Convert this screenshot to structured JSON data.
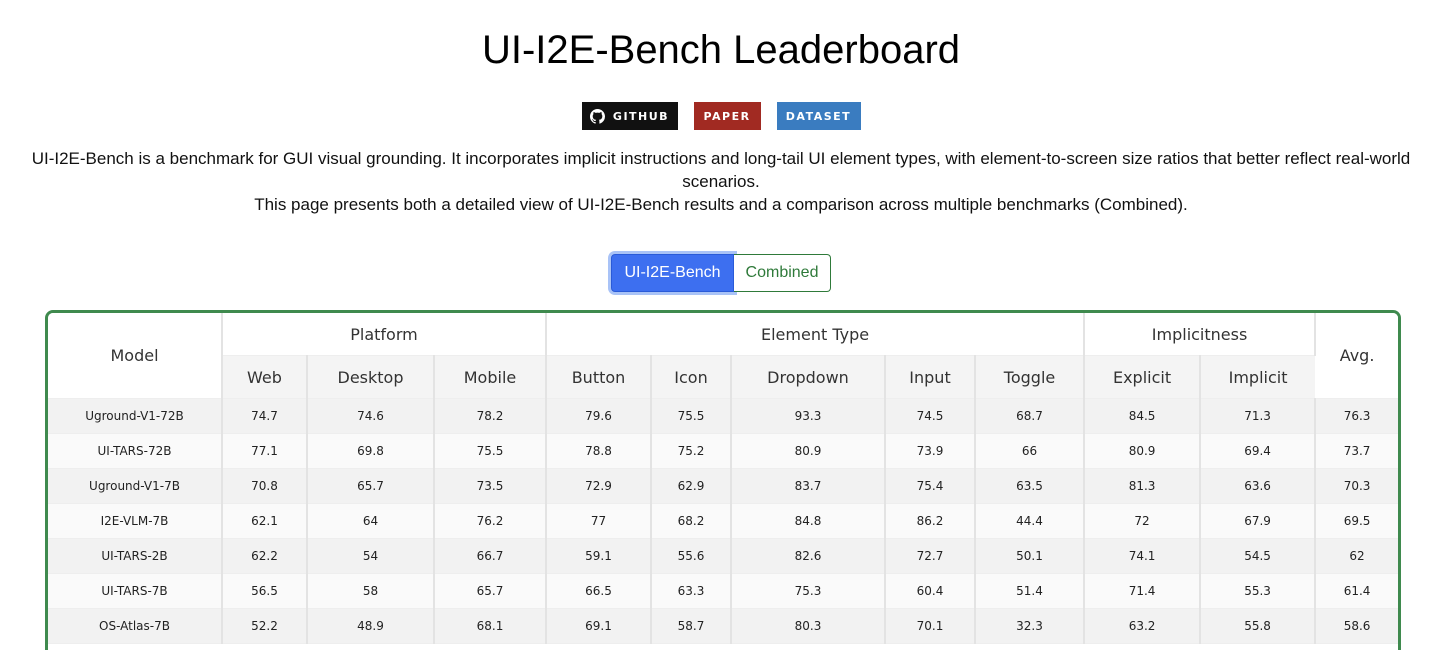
{
  "page": {
    "title": "UI-I2E-Bench Leaderboard",
    "description_line1": "UI-I2E-Bench is a benchmark for GUI visual grounding. It incorporates implicit instructions and long-tail UI element types, with element-to-screen size ratios that better reflect real-world scenarios.",
    "description_line2": "This page presents both a detailed view of UI-I2E-Bench results and a comparison across multiple benchmarks (Combined)."
  },
  "badges": {
    "github": {
      "label": "GITHUB",
      "icon": "github-icon",
      "color": "#111111"
    },
    "paper": {
      "label": "PAPER",
      "color": "#a12a22"
    },
    "dataset": {
      "label": "DATASET",
      "color": "#3a7cc0"
    }
  },
  "view_toggle": {
    "options": [
      "UI-I2E-Bench",
      "Combined"
    ],
    "selected": "UI-I2E-Bench",
    "active_color": "#3d6ff0",
    "inactive_color": "#2f7a3a"
  },
  "table": {
    "groups": {
      "model": "Model",
      "platform": "Platform",
      "element_type": "Element Type",
      "implicitness": "Implicitness",
      "avg": "Avg."
    },
    "subheaders": [
      "Web",
      "Desktop",
      "Mobile",
      "Button",
      "Icon",
      "Dropdown",
      "Input",
      "Toggle",
      "Explicit",
      "Implicit"
    ],
    "rows": [
      [
        "Uground-V1-72B",
        "74.7",
        "74.6",
        "78.2",
        "79.6",
        "75.5",
        "93.3",
        "74.5",
        "68.7",
        "84.5",
        "71.3",
        "76.3"
      ],
      [
        "UI-TARS-72B",
        "77.1",
        "69.8",
        "75.5",
        "78.8",
        "75.2",
        "80.9",
        "73.9",
        "66",
        "80.9",
        "69.4",
        "73.7"
      ],
      [
        "Uground-V1-7B",
        "70.8",
        "65.7",
        "73.5",
        "72.9",
        "62.9",
        "83.7",
        "75.4",
        "63.5",
        "81.3",
        "63.6",
        "70.3"
      ],
      [
        "I2E-VLM-7B",
        "62.1",
        "64",
        "76.2",
        "77",
        "68.2",
        "84.8",
        "86.2",
        "44.4",
        "72",
        "67.9",
        "69.5"
      ],
      [
        "UI-TARS-2B",
        "62.2",
        "54",
        "66.7",
        "59.1",
        "55.6",
        "82.6",
        "72.7",
        "50.1",
        "74.1",
        "54.5",
        "62"
      ],
      [
        "UI-TARS-7B",
        "56.5",
        "58",
        "65.7",
        "66.5",
        "63.3",
        "75.3",
        "60.4",
        "51.4",
        "71.4",
        "55.3",
        "61.4"
      ],
      [
        "OS-Atlas-7B",
        "52.2",
        "48.9",
        "68.1",
        "69.1",
        "58.7",
        "80.3",
        "70.1",
        "32.3",
        "63.2",
        "55.8",
        "58.6"
      ]
    ],
    "border_color": "#3f8a4e"
  }
}
